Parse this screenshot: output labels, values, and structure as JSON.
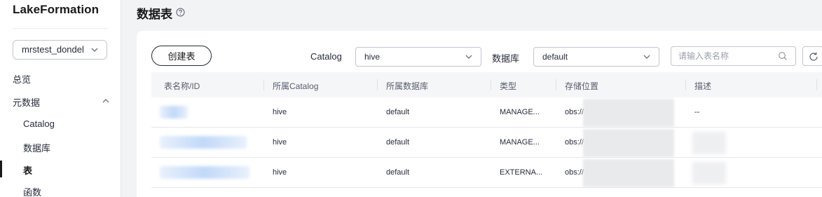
{
  "sidebar": {
    "brand": "LakeFormation",
    "instance_select": {
      "value": "mrstest_dondel"
    },
    "nav": {
      "overview": "总览",
      "metadata": "元数据",
      "catalog": "Catalog",
      "database": "数据库",
      "table": "表",
      "function": "函数"
    },
    "active_item": "表"
  },
  "main": {
    "title": "数据表",
    "create_button": "创建表",
    "filters": {
      "catalog_label": "Catalog",
      "catalog_value": "hive",
      "database_label": "数据库",
      "database_value": "default",
      "search_placeholder": "请输入表名称"
    },
    "table": {
      "columns": [
        "表名称/ID",
        "所属Catalog",
        "所属数据库",
        "类型",
        "存储位置",
        "描述"
      ],
      "rows": [
        {
          "name": "",
          "catalog": "hive",
          "database": "default",
          "type": "MANAGE...",
          "location": "obs://",
          "description": "--"
        },
        {
          "name": "",
          "catalog": "hive",
          "database": "default",
          "type": "MANAGE...",
          "location": "obs://",
          "description": ""
        },
        {
          "name": "",
          "catalog": "hive",
          "database": "default",
          "type": "EXTERNA...",
          "location": "obs://",
          "description": ""
        }
      ]
    }
  },
  "colors": {
    "background": "#f1f3f5",
    "panel": "#ffffff",
    "text": "#252b3a",
    "active_bar": "#191919",
    "header_bg": "#f5f6f8"
  }
}
